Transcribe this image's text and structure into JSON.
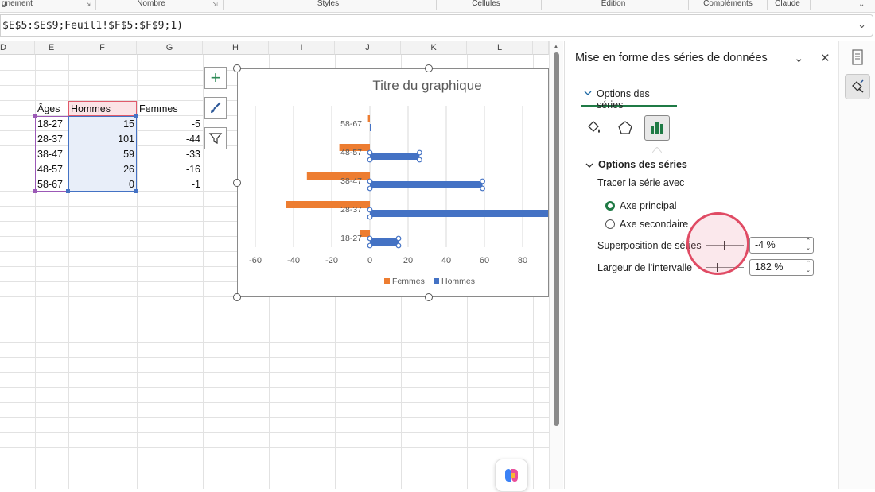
{
  "ribbon": {
    "groups": [
      "gnement",
      "Nombre",
      "Styles",
      "Cellules",
      "Édition",
      "Compléments",
      "Claude"
    ]
  },
  "formula_bar": {
    "text": "$E$5:$E$9;Feuil1!$F$5:$F$9;1)"
  },
  "sheet": {
    "columns": [
      "D",
      "E",
      "F",
      "G",
      "H",
      "I",
      "J",
      "K",
      "L"
    ],
    "headers": {
      "ages": "Âges",
      "hommes": "Hommes",
      "femmes": "Femmes"
    },
    "rows": [
      {
        "age": "18-27",
        "hommes": "15",
        "femmes": "-5"
      },
      {
        "age": "28-37",
        "hommes": "101",
        "femmes": "-44"
      },
      {
        "age": "38-47",
        "hommes": "59",
        "femmes": "-33"
      },
      {
        "age": "48-57",
        "hommes": "26",
        "femmes": "-16"
      },
      {
        "age": "58-67",
        "hommes": "0",
        "femmes": "-1"
      }
    ]
  },
  "chart_data": {
    "type": "bar",
    "orientation": "horizontal",
    "title": "Titre du graphique",
    "categories": [
      "18-27",
      "28-37",
      "38-47",
      "48-57",
      "58-67"
    ],
    "series": [
      {
        "name": "Femmes",
        "values": [
          -5,
          -44,
          -33,
          -16,
          -1
        ],
        "color": "#ED7D31"
      },
      {
        "name": "Hommes",
        "values": [
          15,
          101,
          59,
          26,
          0
        ],
        "color": "#4472C4"
      }
    ],
    "x_ticks": [
      "-60",
      "-40",
      "-20",
      "0",
      "20",
      "40",
      "60",
      "80"
    ],
    "xlim": [
      -60,
      80
    ],
    "grid": true,
    "legend_position": "bottom",
    "selected_series": "Hommes"
  },
  "pane": {
    "title": "Mise en forme des séries de données",
    "tab_label": "Options des séries",
    "section_label": "Options des séries",
    "plot_on_label": "Tracer la série avec",
    "radio_primary": "Axe principal",
    "radio_secondary": "Axe secondaire",
    "overlap_label": "Superposition de séries",
    "overlap_value": "-4 %",
    "gap_label": "Largeur de l'intervalle",
    "gap_value": "182 %",
    "overlap_level": 0.48,
    "gap_level": 0.3
  },
  "colors": {
    "accent_green": "#1F7A45",
    "cursor_ring": "#E04B64",
    "selection_purple": "#9B59B6",
    "selection_blue": "#4472C4",
    "selection_red": "#E05A6B"
  }
}
